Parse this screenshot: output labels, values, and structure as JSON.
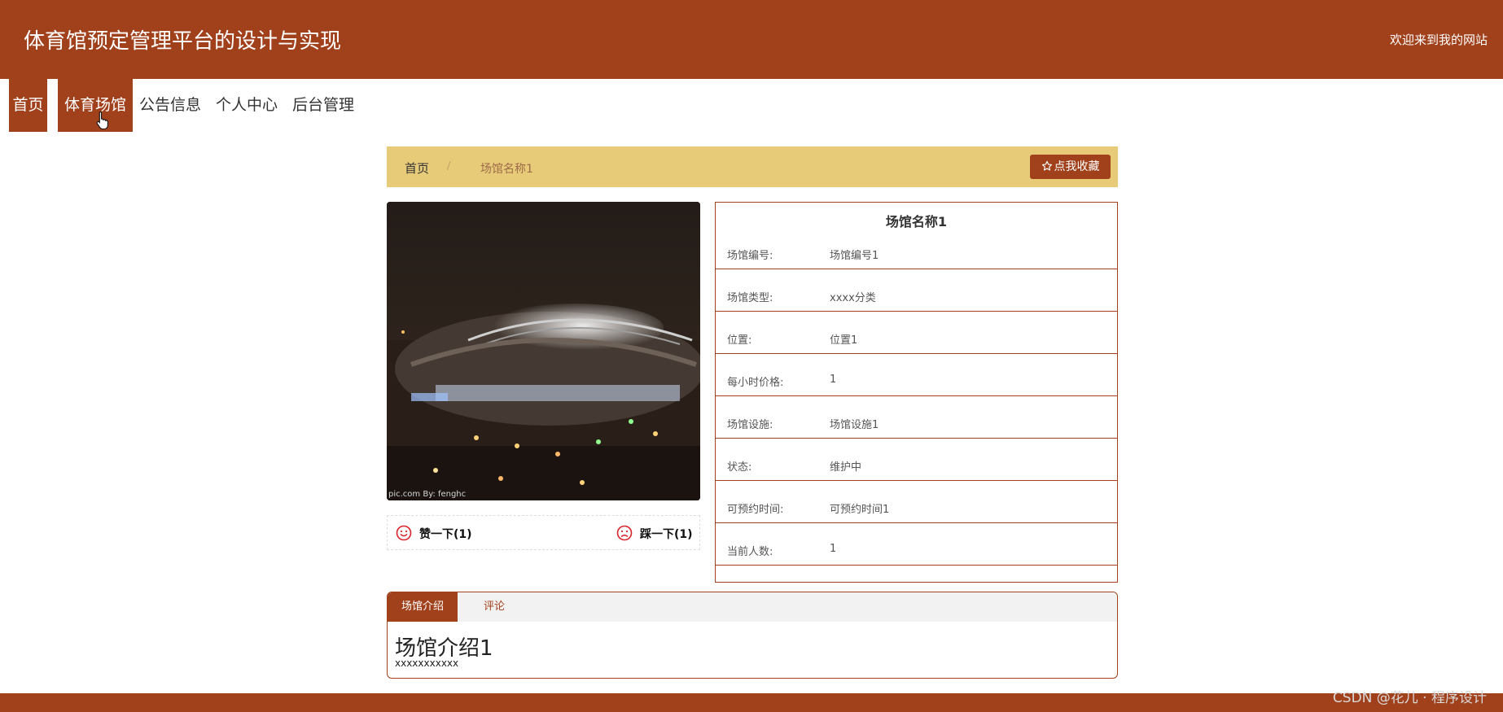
{
  "header": {
    "site_title": "体育馆预定管理平台的设计与实现",
    "welcome": "欢迎来到我的网站"
  },
  "nav": {
    "items": [
      {
        "label": "首页",
        "active": true
      },
      {
        "label": "体育场馆",
        "active": true
      },
      {
        "label": "公告信息",
        "active": false
      },
      {
        "label": "个人中心",
        "active": false
      },
      {
        "label": "后台管理",
        "active": false
      }
    ]
  },
  "breadcrumb": {
    "home": "首页",
    "separator": "/",
    "current": "场馆名称1",
    "favorite_button": "点我收藏",
    "favorite_icon": "star-outline-icon"
  },
  "photo": {
    "watermark": "pic.com   By: fenghc",
    "subject": "stadium at night"
  },
  "votes": {
    "like_label": "赞一下(1)",
    "dislike_label": "踩一下(1)",
    "like_icon": "smile-face-icon",
    "dislike_icon": "sad-face-icon"
  },
  "details": {
    "title": "场馆名称1",
    "rows": [
      {
        "key": "场馆编号:",
        "value": "场馆编号1"
      },
      {
        "key": "场馆类型:",
        "value": "xxxx分类"
      },
      {
        "key": "位置:",
        "value": "位置1"
      },
      {
        "key": "每小时价格:",
        "value": "1"
      },
      {
        "key": "场馆设施:",
        "value": "场馆设施1"
      },
      {
        "key": "状态:",
        "value": "维护中"
      },
      {
        "key": "可预约时间:",
        "value": "可预约时间1"
      },
      {
        "key": "当前人数:",
        "value": "1"
      }
    ]
  },
  "tabs": {
    "intro_tab": "场馆介绍",
    "comment_tab": "评论",
    "intro_heading": "场馆介绍1",
    "intro_body": "xxxxxxxxxxx"
  },
  "overlay": {
    "csdn_watermark": "CSDN @花儿 · 程序设计"
  },
  "colors": {
    "brand": "#a1411c",
    "breadcrumb_bg": "#e8cb78",
    "vote_icon": "#d9232a"
  }
}
